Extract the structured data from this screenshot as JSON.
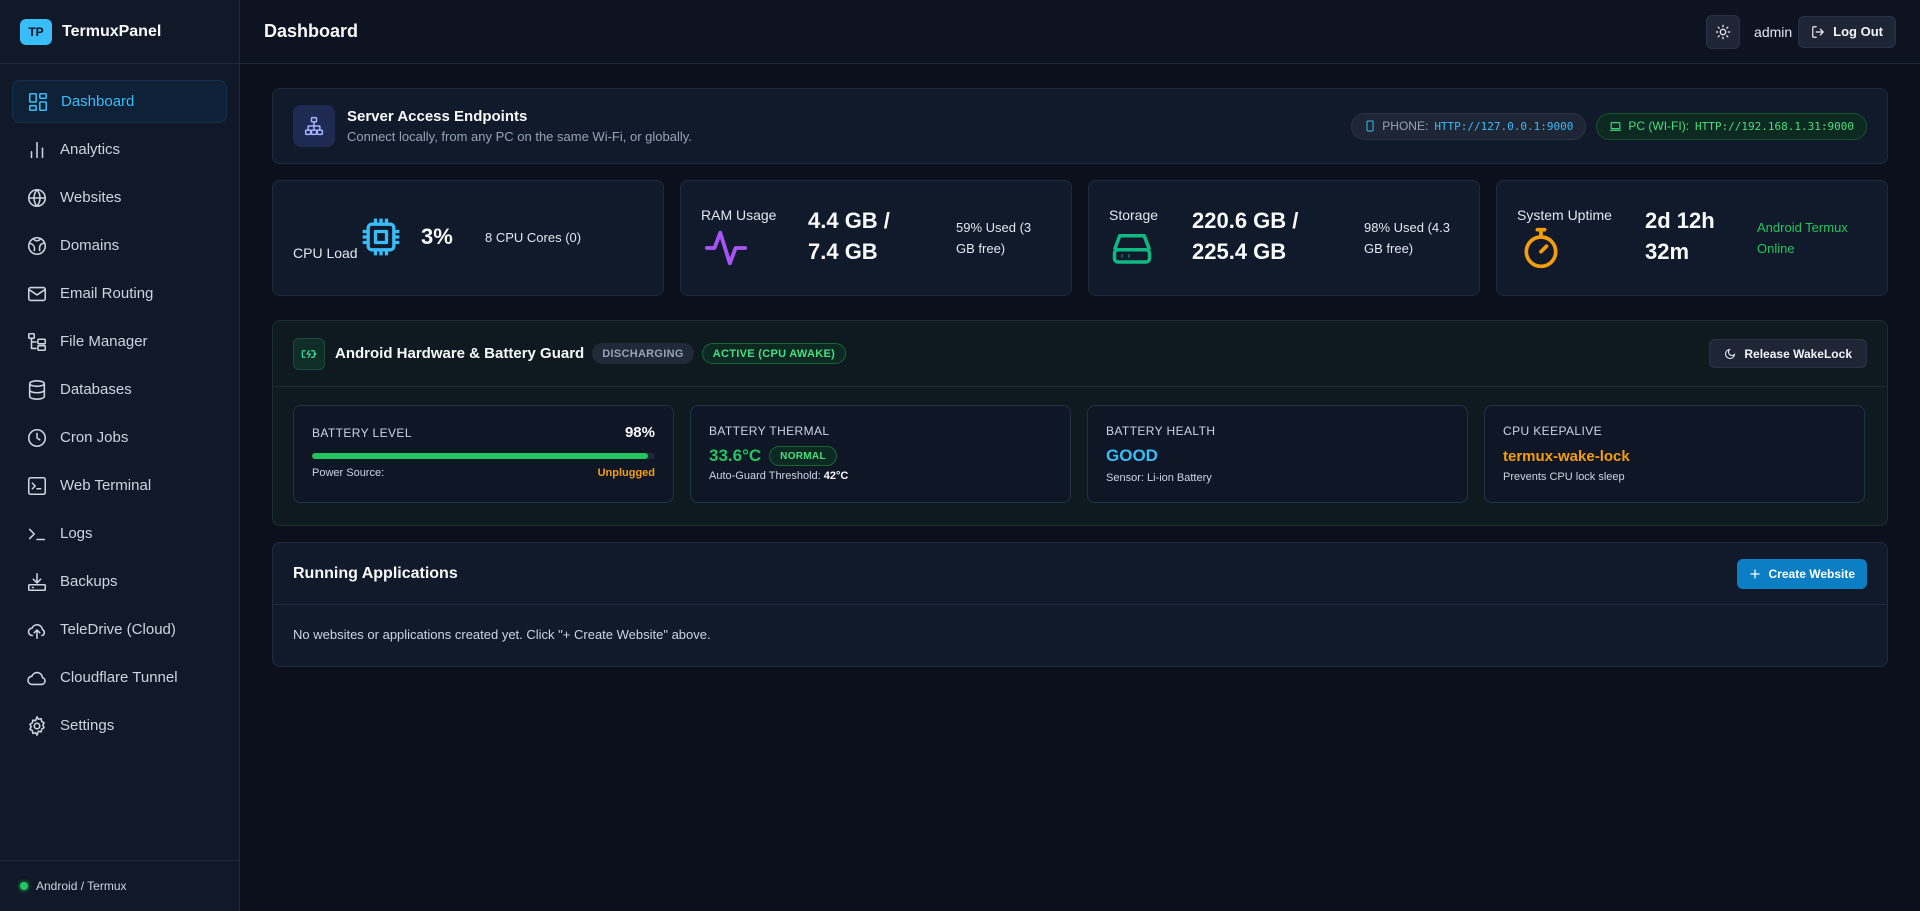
{
  "brand": {
    "logo": "TP",
    "name": "TermuxPanel"
  },
  "sidebar": {
    "items": [
      {
        "label": "Dashboard",
        "icon": "dashboard-icon",
        "active": true
      },
      {
        "label": "Analytics",
        "icon": "analytics-icon"
      },
      {
        "label": "Websites",
        "icon": "globe-icon"
      },
      {
        "label": "Domains",
        "icon": "domains-icon"
      },
      {
        "label": "Email Routing",
        "icon": "mail-icon"
      },
      {
        "label": "File Manager",
        "icon": "file-tree-icon"
      },
      {
        "label": "Databases",
        "icon": "database-icon"
      },
      {
        "label": "Cron Jobs",
        "icon": "clock-icon"
      },
      {
        "label": "Web Terminal",
        "icon": "terminal-icon"
      },
      {
        "label": "Logs",
        "icon": "prompt-icon"
      },
      {
        "label": "Backups",
        "icon": "download-tray-icon"
      },
      {
        "label": "TeleDrive (Cloud)",
        "icon": "cloud-upload-icon"
      },
      {
        "label": "Cloudflare Tunnel",
        "icon": "cloud-icon"
      },
      {
        "label": "Settings",
        "icon": "gear-icon"
      }
    ],
    "footer": "Android / Termux"
  },
  "header": {
    "title": "Dashboard",
    "user": "admin",
    "logout": "Log Out"
  },
  "endpoints": {
    "title": "Server Access Endpoints",
    "subtitle": "Connect locally, from any PC on the same Wi-Fi, or globally.",
    "phone_label": "PHONE:",
    "phone_url": "HTTP://127.0.0.1:9000",
    "pc_label": "PC (WI-FI):",
    "pc_url": "HTTP://192.168.1.31:9000"
  },
  "stats": {
    "cpu": {
      "label": "CPU Load",
      "value": "3%",
      "side": "8 CPU Cores (0)"
    },
    "ram": {
      "label": "RAM Usage",
      "value_line1": "4.4 GB /",
      "value_line2": "7.4 GB",
      "side_line1": "59% Used (3",
      "side_line2": "GB free)"
    },
    "storage": {
      "label": "Storage",
      "value_line1": "220.6 GB /",
      "value_line2": "225.4 GB",
      "side_line1": "98% Used (4.3",
      "side_line2": "GB free)"
    },
    "uptime": {
      "label": "System Uptime",
      "value_line1": "2d 12h",
      "value_line2": "32m",
      "side_line1": "Android Termux",
      "side_line2": "Online"
    }
  },
  "hardware": {
    "title": "Android Hardware & Battery Guard",
    "badge_state": "DISCHARGING",
    "badge_active": "ACTIVE (CPU AWAKE)",
    "release_button": "Release WakeLock",
    "battery_level": {
      "label": "BATTERY LEVEL",
      "value": "98%",
      "level": 0.98,
      "source_label": "Power Source:",
      "source_value": "Unplugged"
    },
    "thermal": {
      "label": "BATTERY THERMAL",
      "value": "33.6°C",
      "status": "NORMAL",
      "threshold_label": "Auto-Guard Threshold:",
      "threshold_value": "42°C"
    },
    "health": {
      "label": "BATTERY HEALTH",
      "value": "GOOD",
      "sensor": "Sensor: Li-ion Battery"
    },
    "keepalive": {
      "label": "CPU KEEPALIVE",
      "value": "termux-wake-lock",
      "sub": "Prevents CPU lock sleep"
    }
  },
  "apps": {
    "title": "Running Applications",
    "create_button": "Create Website",
    "empty": "No websites or applications created yet. Click \"+ Create Website\" above."
  },
  "colors": {
    "accent": "#38bdf8",
    "green": "#22c55e",
    "orange": "#f59e0b",
    "purple": "#a855f7"
  }
}
